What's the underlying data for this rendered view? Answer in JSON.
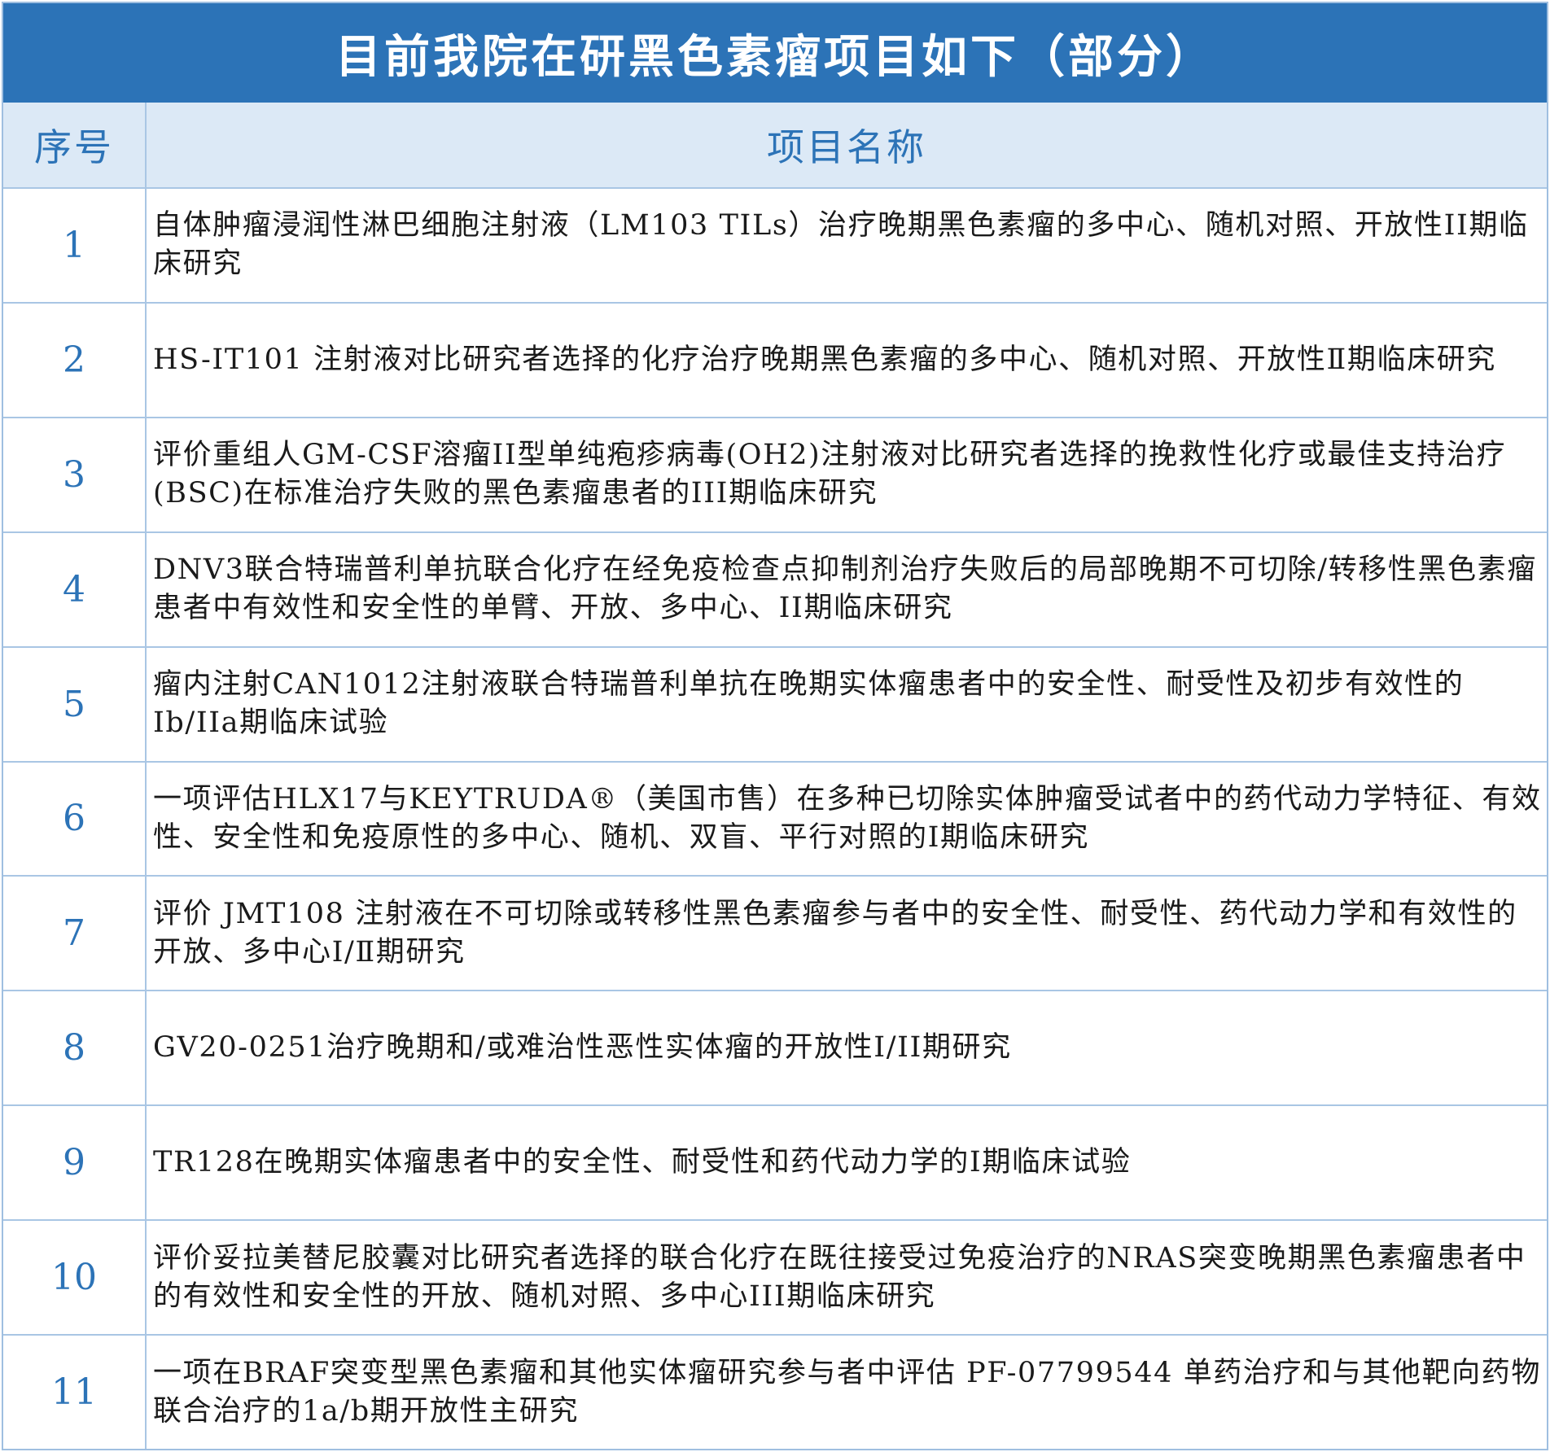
{
  "title": "目前我院在研黑色素瘤项目如下（部分）",
  "header": {
    "index_label": "序号",
    "name_label": "项目名称"
  },
  "rows": [
    {
      "index": "1",
      "name": "自体肿瘤浸润性淋巴细胞注射液（LM103 TILs）治疗晚期黑色素瘤的多中心、随机对照、开放性II期临床研究"
    },
    {
      "index": "2",
      "name": "HS-IT101 注射液对比研究者选择的化疗治疗晚期黑色素瘤的多中心、随机对照、开放性Ⅱ期临床研究"
    },
    {
      "index": "3",
      "name": "评价重组人GM-CSF溶瘤II型单纯疱疹病毒(OH2)注射液对比研究者选择的挽救性化疗或最佳支持治疗(BSC)在标准治疗失败的黑色素瘤患者的III期临床研究"
    },
    {
      "index": "4",
      "name": "DNV3联合特瑞普利单抗联合化疗在经免疫检查点抑制剂治疗失败后的局部晚期不可切除/转移性黑色素瘤患者中有效性和安全性的单臂、开放、多中心、II期临床研究"
    },
    {
      "index": "5",
      "name": "瘤内注射CAN1012注射液联合特瑞普利单抗在晚期实体瘤患者中的安全性、耐受性及初步有效性的Ib/IIa期临床试验"
    },
    {
      "index": "6",
      "name": "一项评估HLX17与KEYTRUDA®（美国市售）在多种已切除实体肿瘤受试者中的药代动力学特征、有效性、安全性和免疫原性的多中心、随机、双盲、平行对照的I期临床研究"
    },
    {
      "index": "7",
      "name": "评价 JMT108 注射液在不可切除或转移性黑色素瘤参与者中的安全性、耐受性、药代动力学和有效性的开放、多中心Ⅰ/Ⅱ期研究"
    },
    {
      "index": "8",
      "name": "GV20-0251治疗晚期和/或难治性恶性实体瘤的开放性I/II期研究"
    },
    {
      "index": "9",
      "name": "TR128在晚期实体瘤患者中的安全性、耐受性和药代动力学的Ⅰ期临床试验"
    },
    {
      "index": "10",
      "name": "评价妥拉美替尼胶囊对比研究者选择的联合化疗在既往接受过免疫治疗的NRAS突变晚期黑色素瘤患者中的有效性和安全性的开放、随机对照、多中心III期临床研究"
    },
    {
      "index": "11",
      "name": "一项在BRAF突变型黑色素瘤和其他实体瘤研究参与者中评估 PF-07799544 单药治疗和与其他靶向药物联合治疗的1a/b期开放性主研究"
    }
  ]
}
